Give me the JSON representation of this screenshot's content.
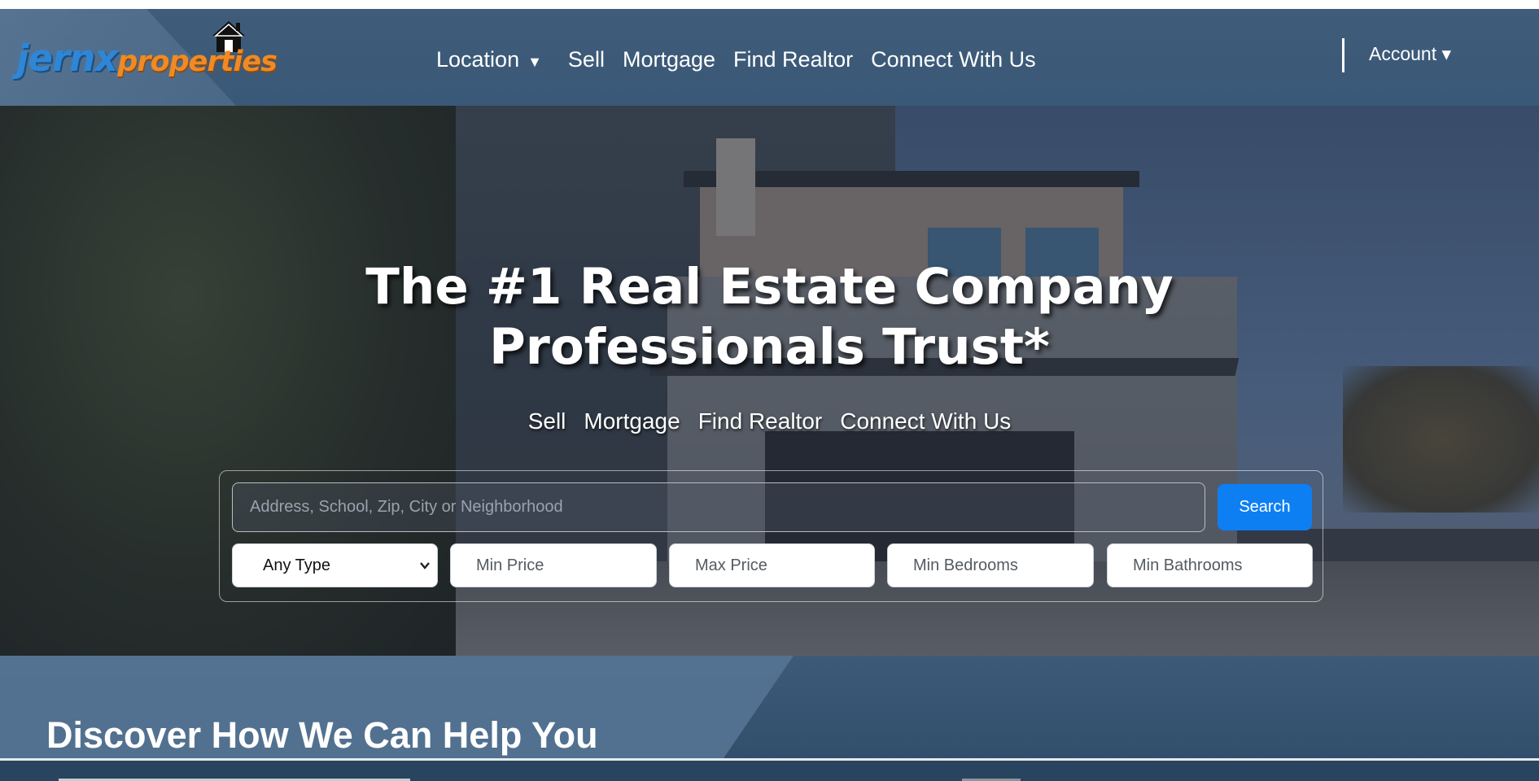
{
  "brand": {
    "logo_part1": "jernx",
    "logo_part2": "properties",
    "logo_icon": "house-icon",
    "color_blue": "#2f86d6",
    "color_orange": "#f08a24"
  },
  "nav": {
    "location_label": "Location",
    "location_icon": "caret-down-icon",
    "sell_label": "Sell",
    "mortgage_label": "Mortgage",
    "find_realtor_label": "Find Realtor",
    "connect_label": "Connect With Us",
    "account_label": "Account ▾"
  },
  "hero": {
    "title_line1": "The #1 Real Estate Company",
    "title_line2": "Professionals Trust*",
    "links": {
      "sell": "Sell",
      "mortgage": "Mortgage",
      "find_realtor": "Find Realtor",
      "connect": "Connect With Us"
    }
  },
  "search": {
    "placeholder": "Address, School, Zip, City or Neighborhood",
    "value": "",
    "button_label": "Search",
    "button_color": "#0d7ff3",
    "type_select_value": "Any Type",
    "min_price_placeholder": "Min Price",
    "max_price_placeholder": "Max Price",
    "min_bedrooms_placeholder": "Min Bedrooms",
    "min_bathrooms_placeholder": "Min Bathrooms"
  },
  "discover": {
    "heading": "Discover How We Can Help You"
  }
}
